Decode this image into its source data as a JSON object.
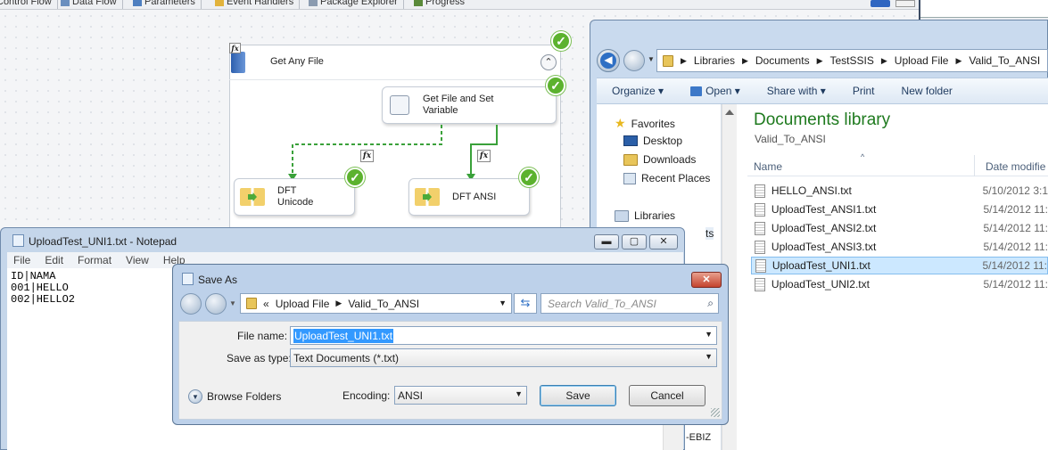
{
  "ssis": {
    "tabs": [
      "Control Flow",
      "Data Flow",
      "Parameters",
      "Event Handlers",
      "Package Explorer",
      "Progress"
    ],
    "container_title": "Get Any File",
    "task_get_file": "Get File and Set Variable",
    "task_dft_unicode": "DFT Unicode",
    "task_dft_ansi": "DFT ANSI",
    "fx": "fx",
    "check": "✓",
    "collapse": "⌃",
    "hidden_tail": "-EBIZ"
  },
  "explorer": {
    "breadcrumb": [
      "Libraries",
      "Documents",
      "TestSSIS",
      "Upload File",
      "Valid_To_ANSI"
    ],
    "toolbar": [
      "Organize ▾",
      "Open ▾",
      "Share with ▾",
      "Print",
      "New folder"
    ],
    "nav": {
      "favorites": "Favorites",
      "desktop": "Desktop",
      "downloads": "Downloads",
      "recent": "Recent Places",
      "libraries": "Libraries",
      "cut_ts": "ts"
    },
    "library_title": "Documents library",
    "library_sub": "Valid_To_ANSI",
    "col_name": "Name",
    "col_date": "Date modifie",
    "files": [
      {
        "name": "HELLO_ANSI.txt",
        "date": "5/10/2012 3:1"
      },
      {
        "name": "UploadTest_ANSI1.txt",
        "date": "5/14/2012 11:"
      },
      {
        "name": "UploadTest_ANSI2.txt",
        "date": "5/14/2012 11:"
      },
      {
        "name": "UploadTest_ANSI3.txt",
        "date": "5/14/2012 11:"
      },
      {
        "name": "UploadTest_UNI1.txt",
        "date": "5/14/2012 11:"
      },
      {
        "name": "UploadTest_UNI2.txt",
        "date": "5/14/2012 11:"
      }
    ],
    "selected_index": 4
  },
  "notepad": {
    "title": "UploadTest_UNI1.txt - Notepad",
    "menu": [
      "File",
      "Edit",
      "Format",
      "View",
      "Help"
    ],
    "content": "ID|NAMA\n001|HELLO\n002|HELLO2",
    "min": "▬",
    "max": "▢",
    "close": "✕"
  },
  "saveas": {
    "title": "Save As",
    "path_prefix": "«",
    "path": [
      "Upload File",
      "Valid_To_ANSI"
    ],
    "search_placeholder": "Search Valid_To_ANSI",
    "file_name_label": "File name:",
    "file_name_value": "UploadTest_UNI1.txt",
    "save_type_label": "Save as type:",
    "save_type_value": "Text Documents (*.txt)",
    "browse_folders": "Browse Folders",
    "encoding_label": "Encoding:",
    "encoding_value": "ANSI",
    "save_label": "Save",
    "cancel_label": "Cancel",
    "close": "✕"
  },
  "colors": {
    "ok_green": "#5cb22e",
    "library_title": "#1e7a1e",
    "selection": "#3399ff",
    "file_selected_bg": "#cce8ff"
  }
}
